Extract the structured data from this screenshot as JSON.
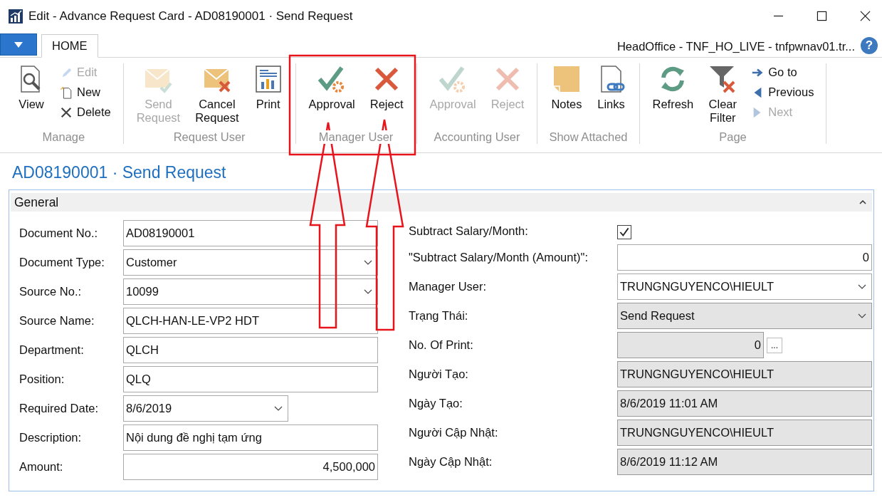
{
  "window": {
    "title": "Edit - Advance Request Card - AD08190001 · Send Request"
  },
  "tabs": [
    {
      "label": "HOME",
      "selected": true
    }
  ],
  "company": "HeadOffice - TNF_HO_LIVE - tnfpwnav01.tr...",
  "help": "?",
  "ribbon": [
    {
      "label": "Manage",
      "buttons": [
        {
          "label": "View",
          "kind": "large",
          "disabled": false
        },
        {
          "label": "Edit",
          "kind": "small",
          "disabled": true
        },
        {
          "label": "New",
          "kind": "small",
          "disabled": false
        },
        {
          "label": "Delete",
          "kind": "small",
          "disabled": false
        }
      ]
    },
    {
      "label": "Request User",
      "buttons": [
        {
          "label": "Send Request",
          "kind": "large",
          "disabled": true
        },
        {
          "label": "Cancel Request",
          "kind": "large",
          "disabled": false
        },
        {
          "label": "Print",
          "kind": "large",
          "disabled": false
        }
      ]
    },
    {
      "label": "Manager User",
      "buttons": [
        {
          "label": "Approval",
          "kind": "large",
          "disabled": false
        },
        {
          "label": "Reject",
          "kind": "large",
          "disabled": false
        }
      ]
    },
    {
      "label": "Accounting User",
      "buttons": [
        {
          "label": "Approval",
          "kind": "large",
          "disabled": true
        },
        {
          "label": "Reject",
          "kind": "large",
          "disabled": true
        }
      ]
    },
    {
      "label": "Show Attached",
      "buttons": [
        {
          "label": "Notes",
          "kind": "large",
          "disabled": false
        },
        {
          "label": "Links",
          "kind": "large",
          "disabled": false
        }
      ]
    },
    {
      "label": "Page",
      "buttons": [
        {
          "label": "Refresh",
          "kind": "large",
          "disabled": false
        },
        {
          "label": "Clear Filter",
          "kind": "large",
          "disabled": false
        },
        {
          "label": "Go to",
          "kind": "small",
          "disabled": false
        },
        {
          "label": "Previous",
          "kind": "small",
          "disabled": false
        },
        {
          "label": "Next",
          "kind": "small",
          "disabled": true
        }
      ]
    }
  ],
  "page_title": "AD08190001 · Send Request",
  "section": {
    "title": "General",
    "expanded": true,
    "left": [
      {
        "label": "Document No.:",
        "kind": "text",
        "value": "AD08190001",
        "editable": true
      },
      {
        "label": "Document Type:",
        "kind": "dropdown",
        "value": "Customer",
        "editable": true
      },
      {
        "label": "Source No.:",
        "kind": "dropdown",
        "value": "10099",
        "editable": true
      },
      {
        "label": "Source Name:",
        "kind": "text",
        "value": "QLCH-HAN-LE-VP2 HDT",
        "editable": true
      },
      {
        "label": "Department:",
        "kind": "text",
        "value": "QLCH",
        "editable": true
      },
      {
        "label": "Position:",
        "kind": "text",
        "value": "QLQ",
        "editable": true
      },
      {
        "label": "Required Date:",
        "kind": "date",
        "value": "8/6/2019",
        "editable": true
      },
      {
        "label": "Description:",
        "kind": "text",
        "value": "Nội dung đề nghị tạm ứng",
        "editable": true
      },
      {
        "label": "Amount:",
        "kind": "number",
        "value": "4,500,000",
        "editable": true
      }
    ],
    "right": [
      {
        "label": "Subtract Salary/Month:",
        "kind": "checkbox",
        "checked": true
      },
      {
        "label": "\"Subtract Salary/Month (Amount)\":",
        "kind": "number",
        "value": "0",
        "editable": true
      },
      {
        "label": "Manager User:",
        "kind": "dropdown",
        "value": "TRUNGNGUYENCO\\HIEULT",
        "editable": true
      },
      {
        "label": "Trạng Thái:",
        "kind": "dropdown",
        "value": "Send Request",
        "editable": false
      },
      {
        "label": "No. Of Print:",
        "kind": "lookup",
        "value": "0",
        "button": "...",
        "editable": false
      },
      {
        "label": "Người Tạo:",
        "kind": "text",
        "value": "TRUNGNGUYENCO\\HIEULT",
        "editable": false
      },
      {
        "label": "Ngày Tạo:",
        "kind": "text",
        "value": "8/6/2019 11:01 AM",
        "editable": false
      },
      {
        "label": "Người Cập Nhật:",
        "kind": "text",
        "value": "TRUNGNGUYENCO\\HIEULT",
        "editable": false
      },
      {
        "label": "Ngày Cập Nhật:",
        "kind": "text",
        "value": "8/6/2019 11:12 AM",
        "editable": false
      }
    ]
  }
}
